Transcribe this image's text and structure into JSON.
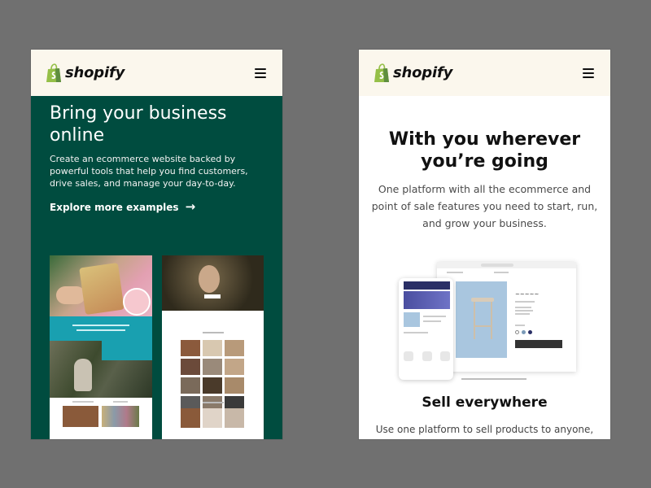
{
  "brand": {
    "name": "shopify",
    "bag_color": "#95BF47",
    "bag_dark": "#5E8E3E"
  },
  "left_screen": {
    "hero_title": "Bring your business online",
    "hero_body": "Create an ecommerce website backed by powerful tools that help you find customers, drive sales, and manage your day-to-day.",
    "explore_link": "Explore more examples",
    "explore_arrow": "→",
    "background_color": "#004C3F"
  },
  "right_screen": {
    "hero_title": "With you wherever you’re going",
    "hero_body": "One platform with all the ecommerce and point of sale features you need to start, run, and grow your business.",
    "sell_heading": "Sell everywhere",
    "sell_body": "Use one platform to sell products to anyone,"
  },
  "icons": {
    "menu": "hamburger-menu-icon",
    "logo": "shopify-bag-icon"
  }
}
